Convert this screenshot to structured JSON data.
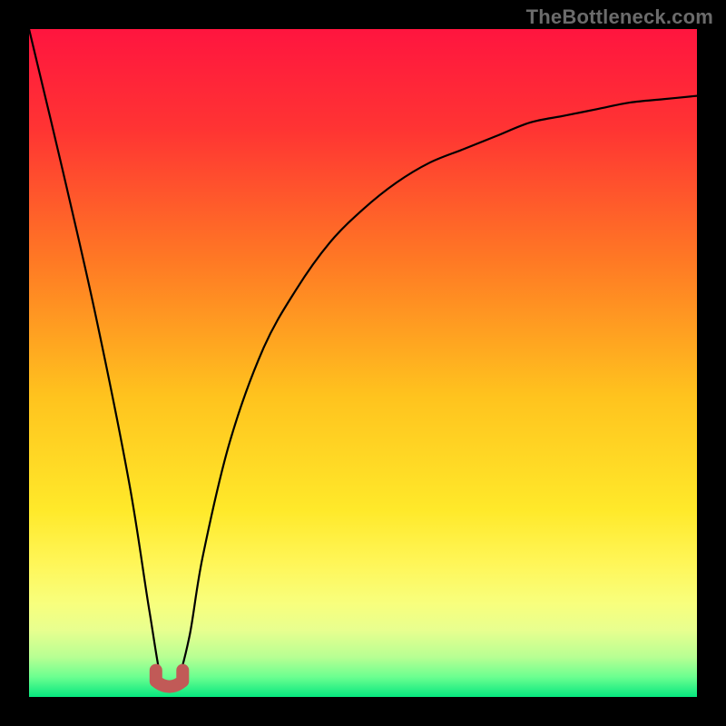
{
  "attribution": "TheBottleneck.com",
  "colors": {
    "frame": "#000000",
    "attribution_text": "#6b6b6b",
    "curve": "#000000",
    "marker": "#c15a57",
    "gradient_stops": [
      {
        "offset": 0.0,
        "hex": "#ff153f"
      },
      {
        "offset": 0.15,
        "hex": "#ff3433"
      },
      {
        "offset": 0.35,
        "hex": "#ff7a24"
      },
      {
        "offset": 0.55,
        "hex": "#ffc31e"
      },
      {
        "offset": 0.72,
        "hex": "#ffe92a"
      },
      {
        "offset": 0.8,
        "hex": "#fff658"
      },
      {
        "offset": 0.86,
        "hex": "#f8ff7d"
      },
      {
        "offset": 0.9,
        "hex": "#e8ff8f"
      },
      {
        "offset": 0.94,
        "hex": "#b8ff93"
      },
      {
        "offset": 0.97,
        "hex": "#6cff90"
      },
      {
        "offset": 1.0,
        "hex": "#06e77f"
      }
    ]
  },
  "chart_data": {
    "type": "line",
    "title": "",
    "xlabel": "",
    "ylabel": "",
    "xlim": [
      0,
      1
    ],
    "ylim": [
      0,
      1
    ],
    "note": "y reads as distance from green baseline (0) up to red top (1); x reads left (0) to right (1). Values estimated from the rendered curve.",
    "series": [
      {
        "name": "bottleneck-curve",
        "x": [
          0.0,
          0.05,
          0.1,
          0.15,
          0.18,
          0.2,
          0.22,
          0.24,
          0.26,
          0.3,
          0.35,
          0.4,
          0.45,
          0.5,
          0.55,
          0.6,
          0.65,
          0.7,
          0.75,
          0.8,
          0.85,
          0.9,
          0.95,
          1.0
        ],
        "y": [
          1.0,
          0.79,
          0.57,
          0.32,
          0.13,
          0.02,
          0.02,
          0.09,
          0.21,
          0.38,
          0.52,
          0.61,
          0.68,
          0.73,
          0.77,
          0.8,
          0.82,
          0.84,
          0.86,
          0.87,
          0.88,
          0.89,
          0.895,
          0.9
        ]
      }
    ],
    "minimum_marker": {
      "shape": "U",
      "x_range": [
        0.19,
        0.23
      ],
      "y": 0.01
    }
  }
}
